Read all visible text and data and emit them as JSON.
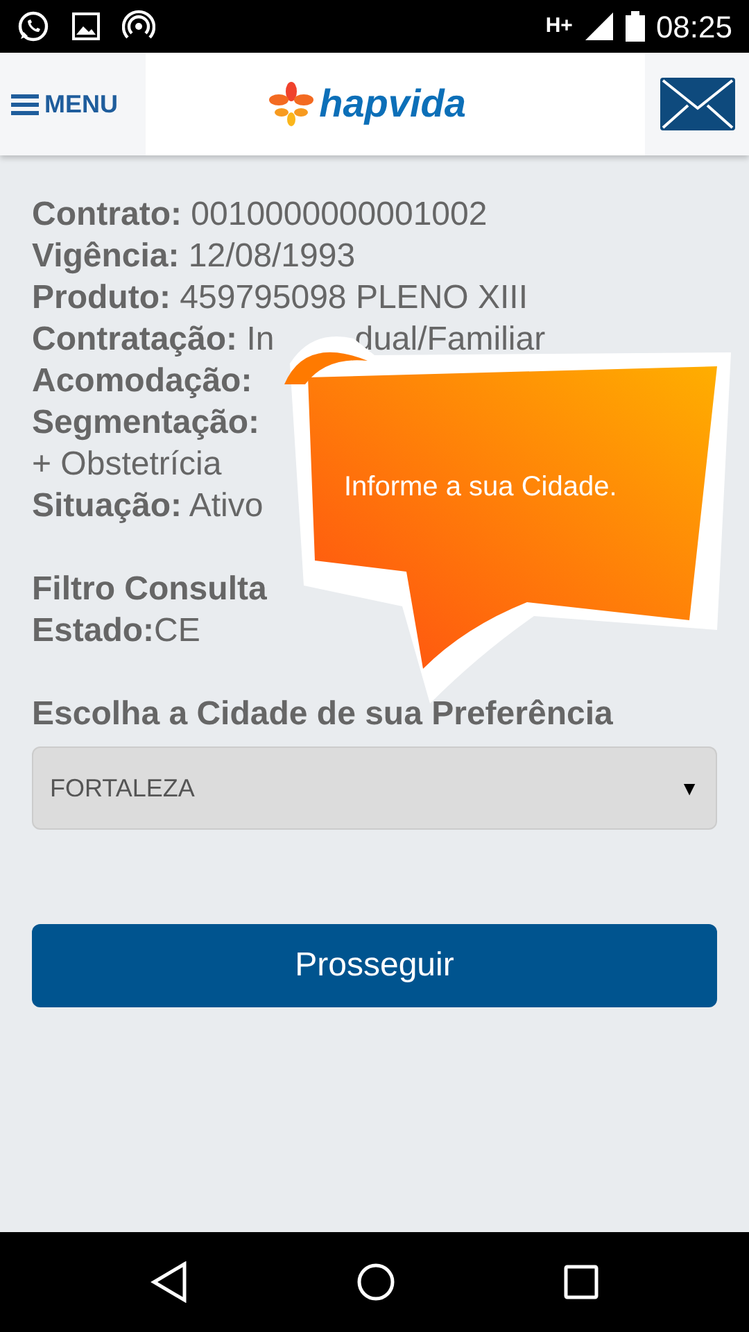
{
  "status_bar": {
    "network": "H+",
    "time": "08:25"
  },
  "header": {
    "menu_label": "MENU",
    "logo_text": "hapvida"
  },
  "fields": [
    {
      "label": "Contrato:",
      "parts": [
        "0010000000001002"
      ]
    },
    {
      "label": "Vigência:",
      "parts": [
        "12/08/1993"
      ]
    },
    {
      "label": "Produto:",
      "parts": [
        "459795098 PLENO XIII"
      ]
    },
    {
      "label": "Contratação:",
      "parts": [
        "In",
        "dual/Familiar"
      ]
    },
    {
      "label": "Acomodação:"
    },
    {
      "label": "Segmentação:"
    },
    {
      "parts": [
        "+ Obstetrícia"
      ]
    },
    {
      "label": "Situação:",
      "parts": [
        "Ativo"
      ]
    }
  ],
  "filter": {
    "title": "Filtro Consulta",
    "state_label": "Estado:",
    "state_value": "CE"
  },
  "city": {
    "label": "Escolha a Cidade de sua Preferência",
    "value": "FORTALEZA",
    "arrow": "▼"
  },
  "button": "Prosseguir",
  "tooltip": "Informe a sua Cidade."
}
